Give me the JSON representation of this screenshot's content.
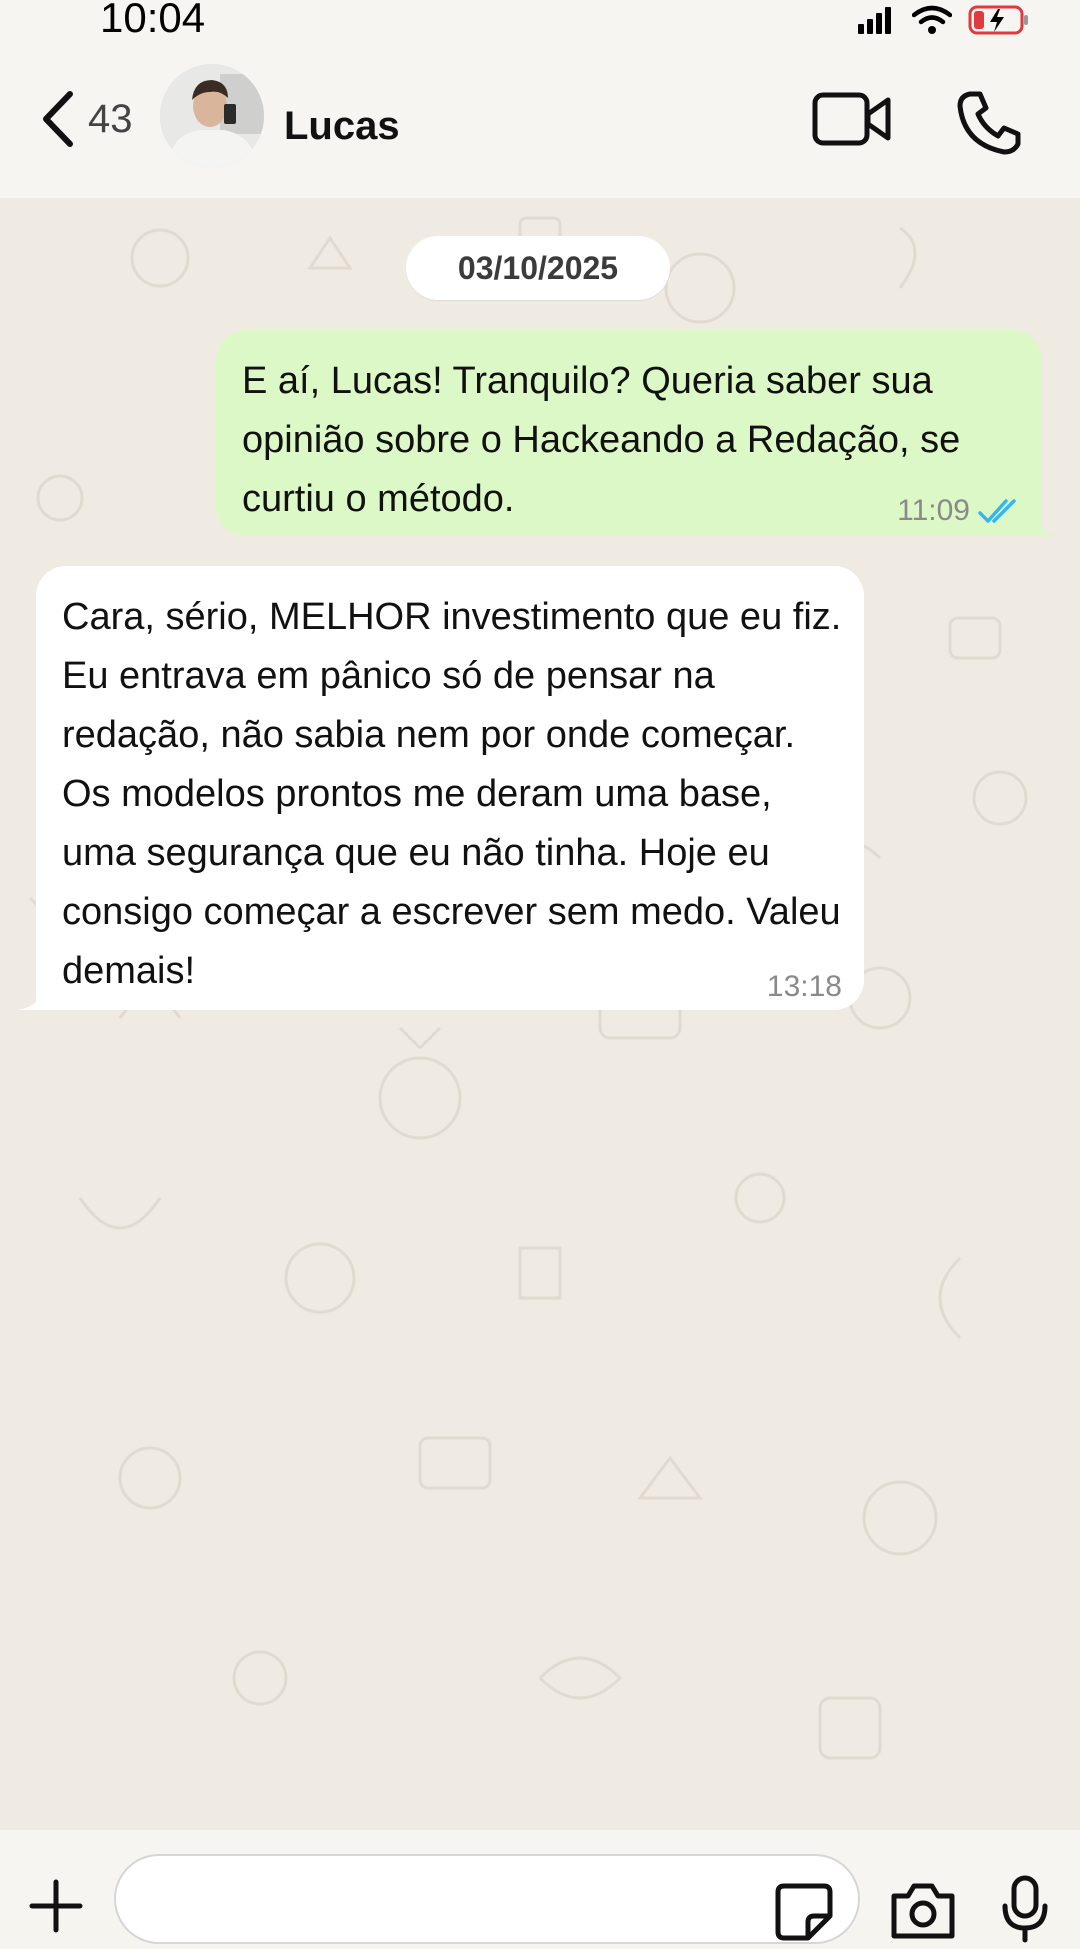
{
  "status_bar": {
    "time": "10:04",
    "icons": [
      "signal-icon",
      "wifi-icon",
      "battery-charging-icon"
    ]
  },
  "header": {
    "back_icon": "chevron-left-icon",
    "unread_count": "43",
    "contact_name": "Lucas",
    "video_icon": "video-camera-icon",
    "call_icon": "phone-icon"
  },
  "chat": {
    "date_label": "03/10/2025",
    "messages": [
      {
        "direction": "outgoing",
        "text": "E aí, Lucas! Tranquilo? Queria saber sua opinião sobre o Hackeando a Redação, se curtiu o método.",
        "time": "11:09",
        "status_icon": "double-check-read-icon"
      },
      {
        "direction": "incoming",
        "text": "Cara, sério, MELHOR investimento que eu fiz. Eu entrava em pânico só de pensar na redação, não sabia nem por onde começar. Os modelos prontos me deram uma base, uma segurança que eu não tinha. Hoje eu consigo começar a escrever sem medo. Valeu demais!",
        "time": "13:18"
      }
    ]
  },
  "composer": {
    "plus_icon": "plus-icon",
    "input_value": "",
    "sticker_icon": "sticker-icon",
    "camera_icon": "camera-icon",
    "mic_icon": "microphone-icon"
  },
  "colors": {
    "outgoing_bubble": "#dcf8c6",
    "incoming_bubble": "#ffffff",
    "chat_background": "#efeae2",
    "read_check": "#34b7f1"
  }
}
